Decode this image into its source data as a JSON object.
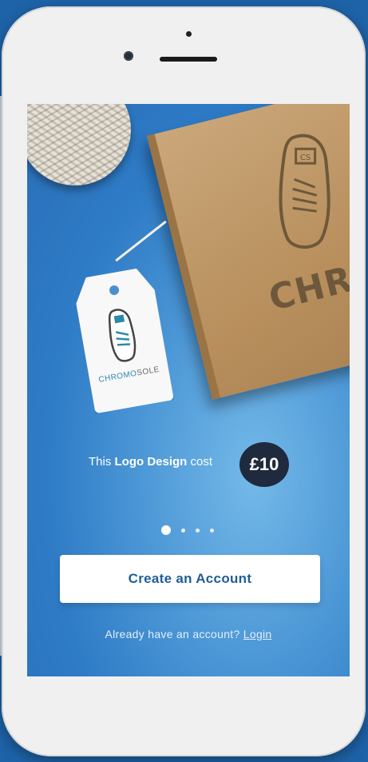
{
  "promo": {
    "prefix": "This ",
    "bold": "Logo Design",
    "suffix": " cost",
    "price": "£10"
  },
  "product": {
    "box_brand": "CHROMOS",
    "tag_brand_part1": "CHROMO",
    "tag_brand_part2": "SOLE",
    "box_logo_letters": "CS"
  },
  "carousel": {
    "page_count": 4,
    "active_index": 0
  },
  "actions": {
    "create_account": "Create an Account",
    "login_prompt": "Already have an account?",
    "login_link": "Login"
  },
  "colors": {
    "brand_blue": "#2e7bc6",
    "badge_navy": "#1f2a3e",
    "button_text": "#1f5e97"
  }
}
